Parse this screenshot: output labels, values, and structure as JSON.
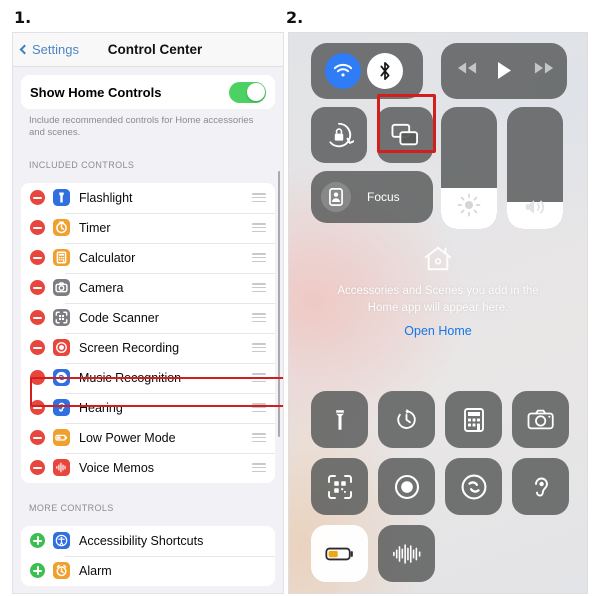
{
  "steps": {
    "one": "1.",
    "two": "2."
  },
  "settings": {
    "nav": {
      "back_label": "Settings",
      "title": "Control Center"
    },
    "home_controls": {
      "label": "Show Home Controls",
      "toggle_state": "on",
      "note": "Include recommended controls for Home accessories and scenes."
    },
    "sections": [
      {
        "heading": "INCLUDED CONTROLS",
        "items": [
          {
            "label": "Flashlight",
            "action": "minus",
            "icon": "flashlight-icon",
            "icon_color": "#2f6fe0"
          },
          {
            "label": "Timer",
            "action": "minus",
            "icon": "timer-icon",
            "icon_color": "#f0a02c"
          },
          {
            "label": "Calculator",
            "action": "minus",
            "icon": "calculator-icon",
            "icon_color": "#f0a02c"
          },
          {
            "label": "Camera",
            "action": "minus",
            "icon": "camera-icon",
            "icon_color": "#7c7c82"
          },
          {
            "label": "Code Scanner",
            "action": "minus",
            "icon": "code-scanner-icon",
            "icon_color": "#7c7c82"
          },
          {
            "label": "Screen Recording",
            "action": "minus",
            "icon": "screen-recording-icon",
            "icon_color": "#e8453c",
            "highlighted": true
          },
          {
            "label": "Music Recognition",
            "action": "minus",
            "icon": "shazam-icon",
            "icon_color": "#2f6fe0"
          },
          {
            "label": "Hearing",
            "action": "minus",
            "icon": "hearing-icon",
            "icon_color": "#2f6fe0"
          },
          {
            "label": "Low Power Mode",
            "action": "minus",
            "icon": "battery-icon",
            "icon_color": "#f0a02c"
          },
          {
            "label": "Voice Memos",
            "action": "minus",
            "icon": "voice-memos-icon",
            "icon_color": "#e8453c"
          }
        ]
      },
      {
        "heading": "MORE CONTROLS",
        "items": [
          {
            "label": "Accessibility Shortcuts",
            "action": "plus",
            "icon": "accessibility-icon",
            "icon_color": "#2f6fe0"
          },
          {
            "label": "Alarm",
            "action": "plus",
            "icon": "alarm-icon",
            "icon_color": "#f0a02c"
          }
        ]
      }
    ]
  },
  "control_center": {
    "connectivity": [
      {
        "name": "wifi-toggle",
        "state": "on",
        "color": "#2f7cf6"
      },
      {
        "name": "bluetooth-toggle",
        "state": "on",
        "color": "#ffffff"
      }
    ],
    "media": [
      {
        "name": "rewind-button"
      },
      {
        "name": "play-button"
      },
      {
        "name": "forward-button"
      }
    ],
    "toggles": [
      {
        "name": "rotation-lock-toggle",
        "state": "off"
      },
      {
        "name": "screen-mirroring-button",
        "state": "off"
      }
    ],
    "sliders": [
      {
        "name": "brightness-slider",
        "value": 34
      },
      {
        "name": "volume-slider",
        "value": 22
      }
    ],
    "focus": {
      "label": "Focus"
    },
    "home": {
      "message": "Accessories and Scenes you add in the Home app will appear here.",
      "link": "Open Home",
      "link_color": "#1676e8"
    },
    "grid": [
      [
        {
          "name": "flashlight-tile",
          "icon": "flashlight-icon",
          "state": "off"
        },
        {
          "name": "timer-tile",
          "icon": "timer-icon",
          "state": "off"
        },
        {
          "name": "calculator-tile",
          "icon": "calculator-icon",
          "state": "off"
        },
        {
          "name": "camera-tile",
          "icon": "camera-icon",
          "state": "off"
        }
      ],
      [
        {
          "name": "code-scanner-tile",
          "icon": "code-scanner-icon",
          "state": "off"
        },
        {
          "name": "screen-recording-tile",
          "icon": "screen-recording-icon",
          "state": "off",
          "highlighted": true
        },
        {
          "name": "music-recognition-tile",
          "icon": "shazam-icon",
          "state": "off"
        },
        {
          "name": "hearing-tile",
          "icon": "hearing-icon",
          "state": "off"
        }
      ],
      [
        {
          "name": "low-power-mode-tile",
          "icon": "battery-icon",
          "state": "on"
        },
        {
          "name": "voice-memos-tile",
          "icon": "voice-memos-icon",
          "state": "off"
        }
      ]
    ]
  },
  "colors": {
    "highlight_border": "#d11f1f",
    "toggle_on": "#4cd263",
    "minus_badge": "#e8453c",
    "plus_badge": "#3dbf4f",
    "ios_blue": "#4c86c6"
  }
}
